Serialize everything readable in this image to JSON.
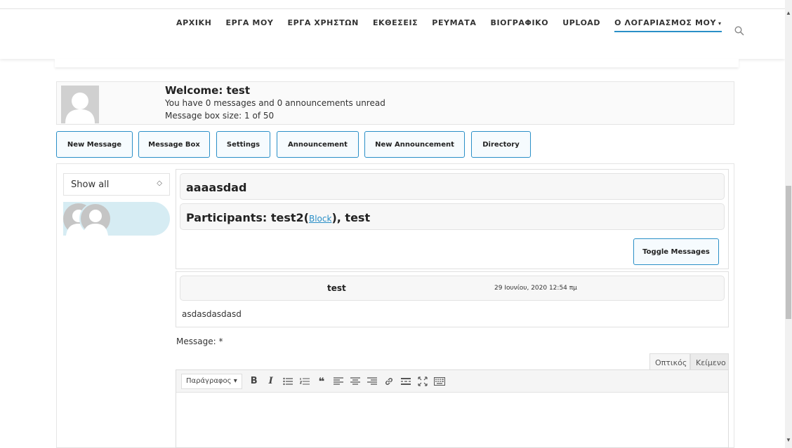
{
  "nav": {
    "items": [
      "ΑΡΧΙΚΗ",
      "ΕΡΓΑ ΜΟΥ",
      "ΕΡΓΑ ΧΡΗΣΤΩΝ",
      "ΕΚΘΕΣΕΙΣ",
      "ΡΕΥΜΑΤΑ",
      "ΒΙΟΓΡΑΦΙΚΟ",
      "UPLOAD"
    ],
    "account": "Ο ΛΟΓΑΡΙΑΣΜΟΣ ΜΟΥ",
    "account_caret": "▾",
    "search_icon": "search-icon"
  },
  "welcome": {
    "title": "Welcome: test",
    "unread": "You have 0 messages and 0 announcements unread",
    "box_size": "Message box size: 1 of 50"
  },
  "buttons": {
    "new_message": "New Message",
    "message_box": "Message Box",
    "settings": "Settings",
    "announcement": "Announcement",
    "new_announcement": "New Announcement",
    "directory": "Directory"
  },
  "filter": {
    "selected": "Show all"
  },
  "thread": {
    "subject": "aaaasdad",
    "participants_prefix": "Participants: test2(",
    "block_link": "Block",
    "participants_suffix": "), test",
    "toggle": "Toggle Messages"
  },
  "message": {
    "author": "test",
    "date": "29 Ιουνίου, 2020 12:54 πμ",
    "body": "asdasdasdasd"
  },
  "editor": {
    "label": "Message: *",
    "tab_visual": "Οπτικός",
    "tab_text": "Κείμενο",
    "format": "Παράγραφος",
    "format_caret": "▾"
  },
  "colors": {
    "accent": "#2a8fc7",
    "conversation_bg": "#d6ecf3"
  }
}
